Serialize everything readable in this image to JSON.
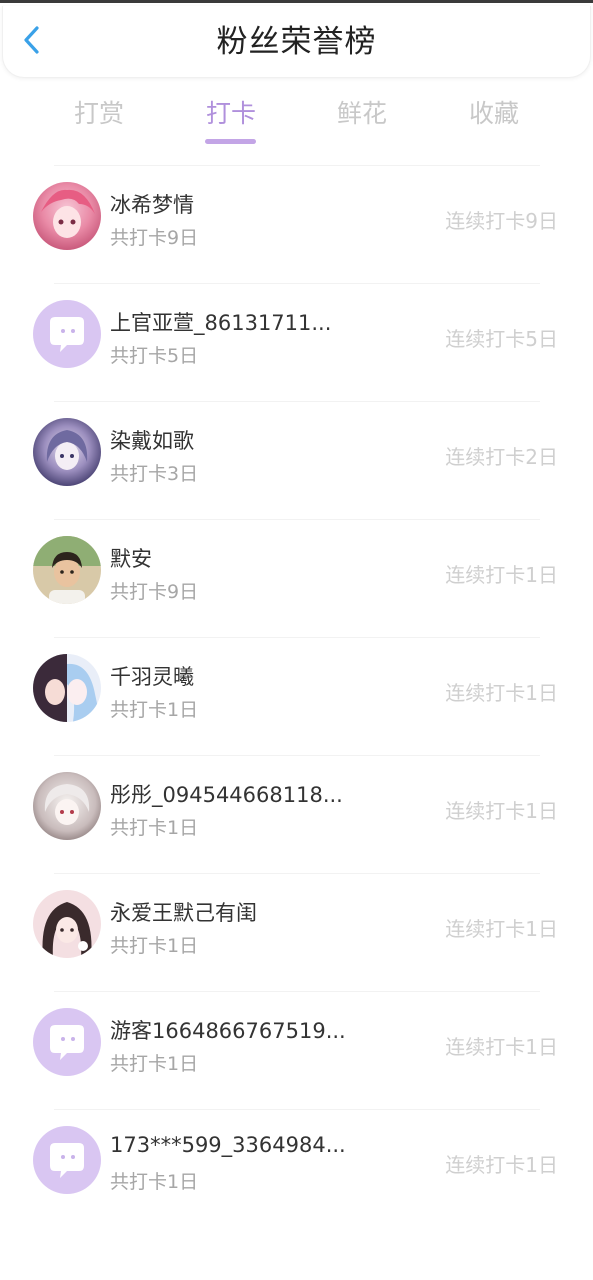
{
  "header": {
    "title": "粉丝荣誉榜",
    "back_icon": "chevron-left-icon",
    "accent_color": "#3aa1e8"
  },
  "tabs": [
    {
      "label": "打赏",
      "active": false
    },
    {
      "label": "打卡",
      "active": true
    },
    {
      "label": "鲜花",
      "active": false
    },
    {
      "label": "收藏",
      "active": false
    }
  ],
  "theme": {
    "active_tab_color": "#b090dc",
    "default_avatar_color": "#d9c6f2"
  },
  "fans": [
    {
      "name": "冰希梦情",
      "total": "共打卡9日",
      "streak": "连续打卡9日",
      "avatar": "photo-pink-anime-girl"
    },
    {
      "name": "上官亚萱_86131711...",
      "total": "共打卡5日",
      "streak": "连续打卡5日",
      "avatar": "default-chat-bubble"
    },
    {
      "name": "染戴如歌",
      "total": "共打卡3日",
      "streak": "连续打卡2日",
      "avatar": "photo-blue-anime-girl"
    },
    {
      "name": "默安",
      "total": "共打卡9日",
      "streak": "连续打卡1日",
      "avatar": "photo-boy"
    },
    {
      "name": "千羽灵曦",
      "total": "共打卡1日",
      "streak": "连续打卡1日",
      "avatar": "photo-two-anime-girls"
    },
    {
      "name": "彤彤_094544668118...",
      "total": "共打卡1日",
      "streak": "连续打卡1日",
      "avatar": "photo-white-anime-girl"
    },
    {
      "name": "永爱王默己有闺",
      "total": "共打卡1日",
      "streak": "连续打卡1日",
      "avatar": "photo-dark-hair-anime-girl"
    },
    {
      "name": "游客1664866767519...",
      "total": "共打卡1日",
      "streak": "连续打卡1日",
      "avatar": "default-chat-bubble"
    },
    {
      "name": "173***599_3364984...",
      "total": "共打卡1日",
      "streak": "连续打卡1日",
      "avatar": "default-chat-bubble"
    }
  ]
}
